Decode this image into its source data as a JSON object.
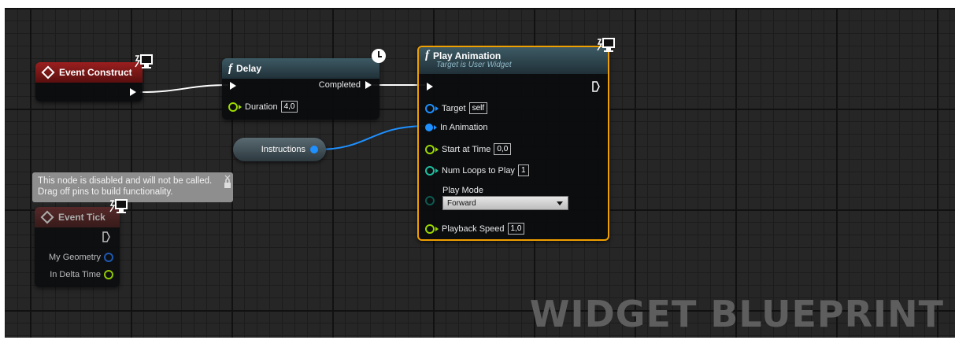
{
  "event_construct": {
    "title": "Event Construct"
  },
  "delay": {
    "title": "Delay",
    "completed": "Completed",
    "duration_label": "Duration",
    "duration_value": "4,0"
  },
  "instructions_var": {
    "label": "Instructions"
  },
  "play_animation": {
    "title": "Play Animation",
    "subtitle": "Target is User Widget",
    "target_label": "Target",
    "target_value": "self",
    "in_animation_label": "In Animation",
    "start_at_time_label": "Start at Time",
    "start_at_time_value": "0,0",
    "num_loops_label": "Num Loops to Play",
    "num_loops_value": "1",
    "play_mode_label": "Play Mode",
    "play_mode_value": "Forward",
    "playback_speed_label": "Playback Speed",
    "playback_speed_value": "1,0"
  },
  "tooltip": {
    "line1": "This node is disabled and will not be called.",
    "line2": "Drag off pins to build functionality."
  },
  "event_tick": {
    "title": "Event Tick",
    "my_geometry_label": "My Geometry",
    "in_delta_time_label": "In Delta Time"
  },
  "watermark": "WIDGET BLUEPRINT",
  "colors": {
    "exec": "#ffffff",
    "object_pin": "#1e90ff",
    "float_pin": "#9cd900",
    "selected_outline": "#f0a000",
    "event_header": "#9a1f1f",
    "function_header": "#3d5a64"
  },
  "icons": [
    "diamond-event-icon",
    "function-icon",
    "monitor-icon",
    "clock-icon",
    "dropdown-caret-icon"
  ]
}
